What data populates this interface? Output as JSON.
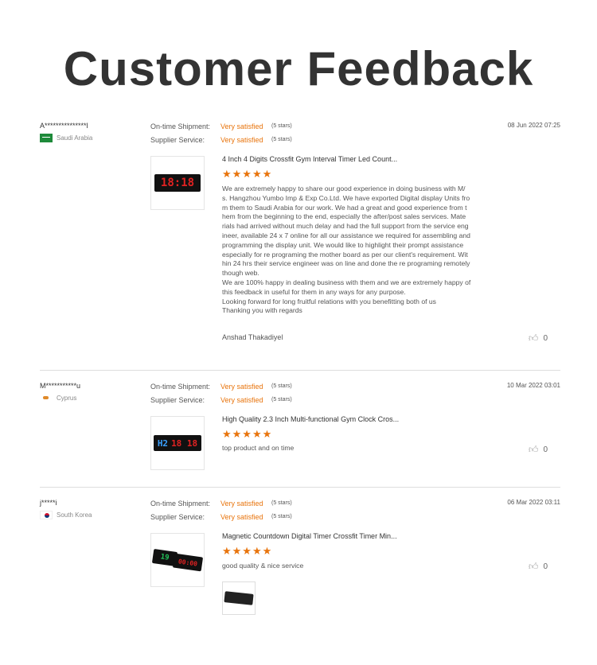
{
  "page_title": "Customer Feedback",
  "reviews": [
    {
      "buyer": "A***************l",
      "country": "Saudi Arabia",
      "shipment_label": "On-time Shipment:",
      "shipment_value": "Very satisfied",
      "shipment_stars": "(5 stars)",
      "service_label": "Supplier Service:",
      "service_value": "Very satisfied",
      "service_stars": "(5 stars)",
      "date": "08 Jun 2022 07:25",
      "product_title": "4 Inch 4 Digits Crossfit Gym Interval Timer Led Count...",
      "display_text": "18:18",
      "rating": 5,
      "stars": "★★★★★",
      "text": "We are extremely happy to share our good experience in doing business  with M/\ns. Hangzhou Yumbo Imp & Exp Co.Ltd.  We have exported Digital display Units fro\nm them to Saudi Arabia for our work.  We had a great and good experience from t\nhem from the beginning to the end, especially the after/post sales services.  Mate\nrials had arrived without much delay and had the full support from the service eng\nineer, available 24 x 7 online for all our assistance we required for assembling and\nprogramming the display unit.  We would like to highlight their prompt assistance\nespecially for re programing the mother board as per our client's requirement.  Wit\nhin 24 hrs their service engineer was on line and done the re programing remotely\nthough web.\nWe are 100% happy in dealing business with them and we are extremely happy of\nthis feedback in useful for them in any ways for any purpose.\nLooking forward for long fruitful relations with you benefitting  both of us\nThanking you with regards",
      "author": "Anshad Thakadiyel",
      "likes": "0"
    },
    {
      "buyer": "M***********u",
      "country": "Cyprus",
      "shipment_label": "On-time Shipment:",
      "shipment_value": "Very satisfied",
      "shipment_stars": "(5 stars)",
      "service_label": "Supplier Service:",
      "service_value": "Very satisfied",
      "service_stars": "(5 stars)",
      "date": "10 Mar 2022 03:01",
      "product_title": "High Quality 2.3 Inch Multi-functional Gym Clock Cros...",
      "display_prefix": "H2",
      "display_text": "18 18",
      "rating": 5,
      "stars": "★★★★★",
      "text": "top product and on time",
      "likes": "0"
    },
    {
      "buyer": "j*****i",
      "country": "South Korea",
      "shipment_label": "On-time Shipment:",
      "shipment_value": "Very satisfied",
      "shipment_stars": "(5 stars)",
      "service_label": "Supplier Service:",
      "service_value": "Very satisfied",
      "service_stars": "(5 stars)",
      "date": "06 Mar 2022 03:11",
      "product_title": "Magnetic Countdown Digital Timer Crossfit Timer Min...",
      "display_prefix": "19",
      "display_text": "00:00",
      "rating": 5,
      "stars": "★★★★★",
      "text": "good quality & nice service",
      "likes": "0"
    }
  ],
  "colors": {
    "accent": "#e8740c",
    "title": "#333333",
    "divider": "#dddddd"
  },
  "icons": {
    "like": "thumbs-up-icon"
  }
}
